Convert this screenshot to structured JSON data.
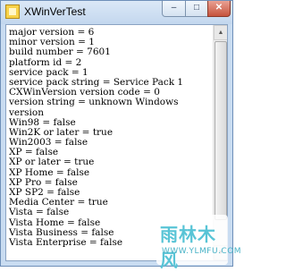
{
  "window": {
    "title": "XWinVerTest",
    "controls": {
      "minimize": "–",
      "maximize": "□",
      "close": "✕"
    }
  },
  "output": {
    "lines": [
      "major version = 6",
      "minor version = 1",
      "build number = 7601",
      "platform id = 2",
      "service pack = 1",
      "service pack string = Service Pack 1",
      "CXWinVersion version code = 0",
      "version string = unknown Windows",
      "version",
      "Win98 = false",
      "Win2K or later = true",
      "Win2003 = false",
      "XP = false",
      "XP or later = true",
      "XP Home = false",
      "XP Pro = false",
      "XP SP2 = false",
      "Media Center = true",
      "Vista = false",
      "Vista Home = false",
      "Vista Business = false",
      "Vista Enterprise = false"
    ]
  },
  "scrollbar": {
    "up_arrow": "▲",
    "down_arrow": "▼"
  },
  "watermark": {
    "logo_text": "雨林木风",
    "url": "WWW.YLMFU.COM"
  }
}
